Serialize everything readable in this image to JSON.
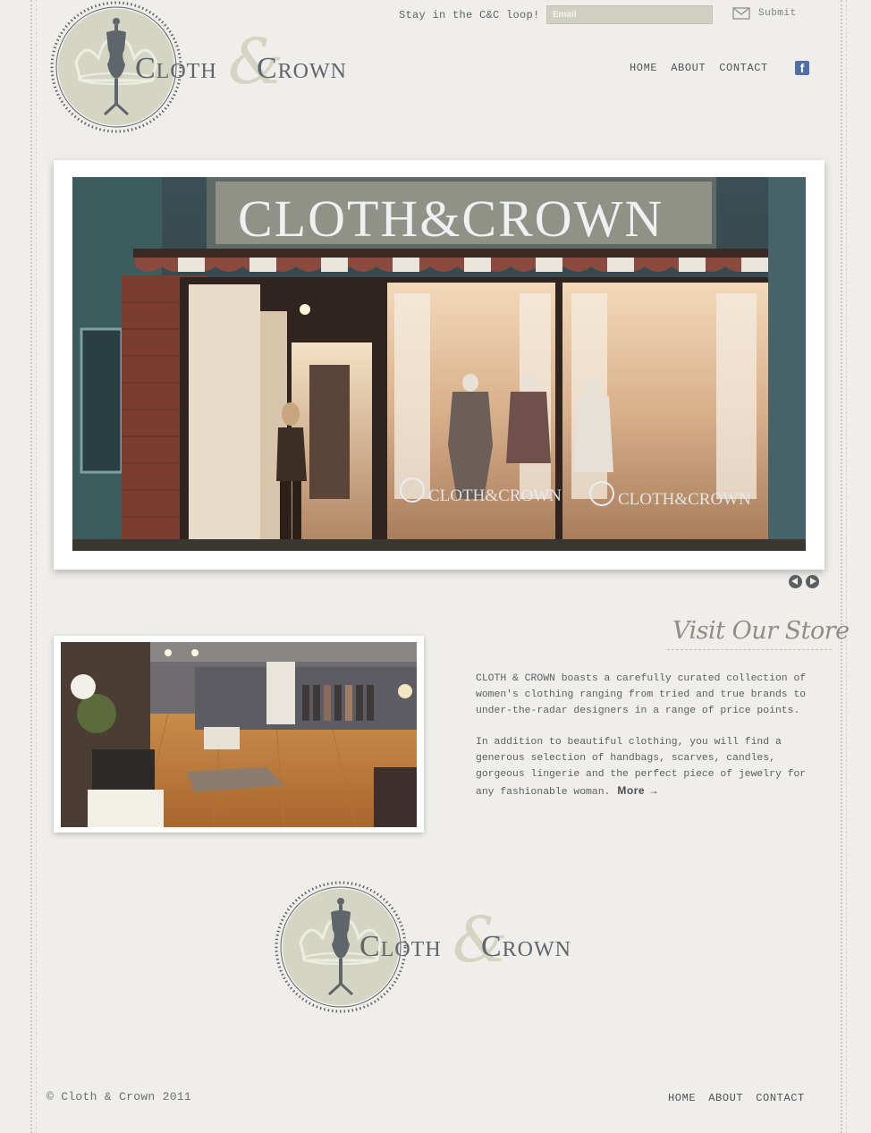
{
  "signup": {
    "prompt": "Stay in the C&C loop!",
    "email_placeholder": "Email",
    "submit_label": "Submit"
  },
  "brand": {
    "name_part1": "Cloth",
    "ampersand": "&",
    "name_part2": "Crown"
  },
  "nav": {
    "items": [
      "HOME",
      "ABOUT",
      "CONTACT"
    ],
    "social": "f"
  },
  "hero": {
    "sign_text": "CLOTH&CROWN",
    "window_text": "CLOTH&CROWN"
  },
  "store": {
    "heading": "Visit Our Store",
    "paragraph1": "CLOTH & CROWN boasts a carefully curated collection of women's clothing ranging from tried and true brands to under-the-radar designers in a range of price points.",
    "paragraph2": "In addition to beautiful clothing, you will find a generous selection of handbags, scarves, candles, gorgeous lingerie and the perfect piece of jewelry for any fashionable woman.",
    "more_label": "More →"
  },
  "footer": {
    "copyright": "© Cloth & Crown 2011",
    "nav": [
      "HOME",
      "ABOUT",
      "CONTACT"
    ]
  },
  "colors": {
    "background": "#efeeea",
    "text": "#5b5f62",
    "seal": "#d4d5c3",
    "facebook": "#4e6fa8"
  }
}
